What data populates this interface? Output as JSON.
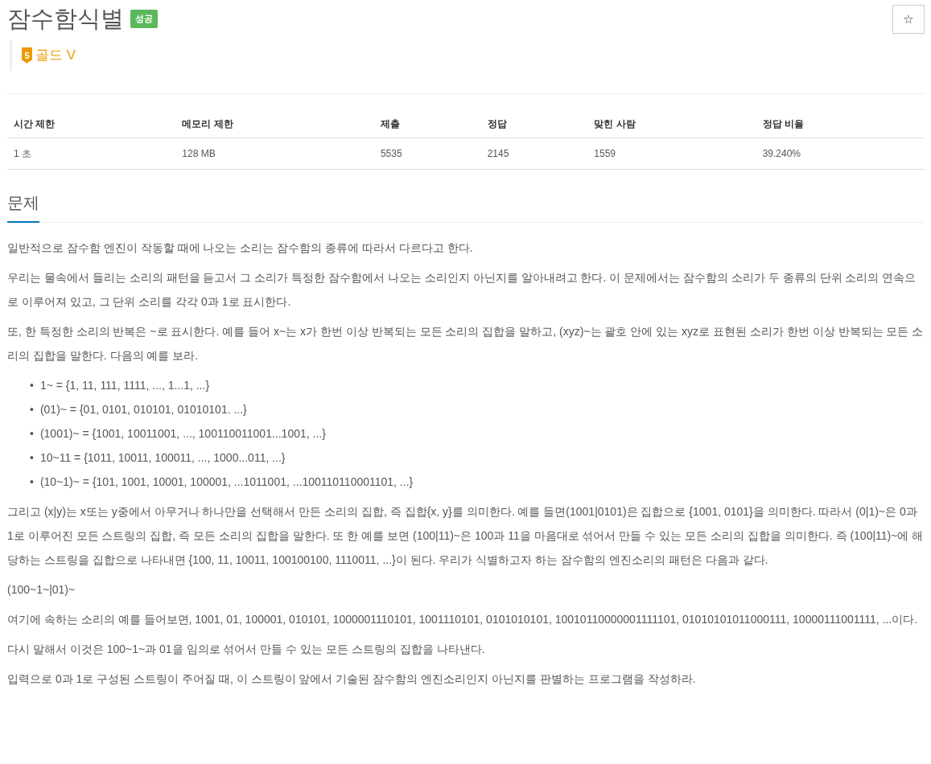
{
  "title": "잠수함식별",
  "result_badge": "성공",
  "star_button": "☆",
  "tier": {
    "level": "5",
    "label": "골드 V"
  },
  "stats": {
    "columns": [
      "시간 제한",
      "메모리 제한",
      "제출",
      "정답",
      "맞힌 사람",
      "정답 비율"
    ],
    "rows": [
      [
        "1 초",
        "128 MB",
        "5535",
        "2145",
        "1559",
        "39.240%"
      ]
    ]
  },
  "section_title": "문제",
  "blocks": [
    {
      "kind": "paragraph",
      "text": "일반적으로 잠수함 엔진이 작동할 때에 나오는 소리는 잠수함의 종류에 따라서 다르다고 한다."
    },
    {
      "kind": "paragraph",
      "text": "우리는 물속에서 들리는 소리의 패턴을 듣고서 그 소리가 특정한 잠수함에서 나오는 소리인지 아닌지를 알아내려고 한다. 이 문제에서는 잠수함의 소리가 두 종류의 단위 소리의 연속으로 이루어져 있고, 그 단위 소리를 각각 0과 1로 표시한다."
    },
    {
      "kind": "paragraph",
      "text": "또, 한 특정한 소리의 반복은 ~로 표시한다. 예를 들어 x~는 x가 한번 이상 반복되는 모든 소리의 집합을 말하고, (xyz)~는 괄호 안에 있는 xyz로 표현된 소리가 한번 이상 반복되는 모든 소리의 집합을 말한다. 다음의 예를 보라."
    },
    {
      "kind": "list",
      "marker": "•",
      "items": [
        "1~ = {1, 11, 111, 1111, ..., 1...1, ...}",
        "(01)~ = {01, 0101, 010101, 01010101. ...}",
        "(1001)~ = {1001, 10011001, ..., 100110011001...1001, ...}",
        "10~11 = {1011, 10011, 100011, ..., 1000...011, ...}",
        "(10~1)~ = {101, 1001, 10001, 100001, ...1011001, ...100110110001101, ...}"
      ]
    },
    {
      "kind": "paragraph",
      "text": "그리고 (x|y)는 x또는 y중에서 아무거나 하나만을 선택해서 만든 소리의 집합, 즉 집합{x, y}를 의미한다. 예를 들면(1001|0101)은 집합으로 {1001, 0101}을 의미한다. 따라서 (0|1)~은 0과 1로 이루어진 모든 스트링의 집합, 즉 모든 소리의 집합을 말한다. 또 한 예를 보면 (100|11)~은 100과 11을 마음대로 섞어서 만들 수 있는 모든 소리의 집합을 의미한다. 즉 (100|11)~에 해당하는 스트링을 집합으로 나타내면 {100, 11, 10011, 100100100, 1110011, ...}이 된다. 우리가 식별하고자 하는 잠수함의 엔진소리의 패턴은 다음과 같다."
    },
    {
      "kind": "paragraph",
      "text": "(100~1~|01)~"
    },
    {
      "kind": "paragraph",
      "text": "여기에 속하는 소리의 예를 들어보면, 1001, 01, 100001, 010101, 1000001110101, 1001110101, 0101010101, 10010110000001111101, 01010101011000111, 10000111001111, ...이다."
    },
    {
      "kind": "paragraph",
      "text": "다시 말해서 이것은 100~1~과 01을 임의로 섞어서 만들 수 있는 모든 스트링의 집합을 나타낸다."
    },
    {
      "kind": "paragraph",
      "text": "입력으로 0과 1로 구성된 스트링이 주어질 때, 이 스트링이 앞에서 기술된 잠수함의 엔진소리인지 아닌지를 판별하는 프로그램을 작성하라."
    }
  ]
}
